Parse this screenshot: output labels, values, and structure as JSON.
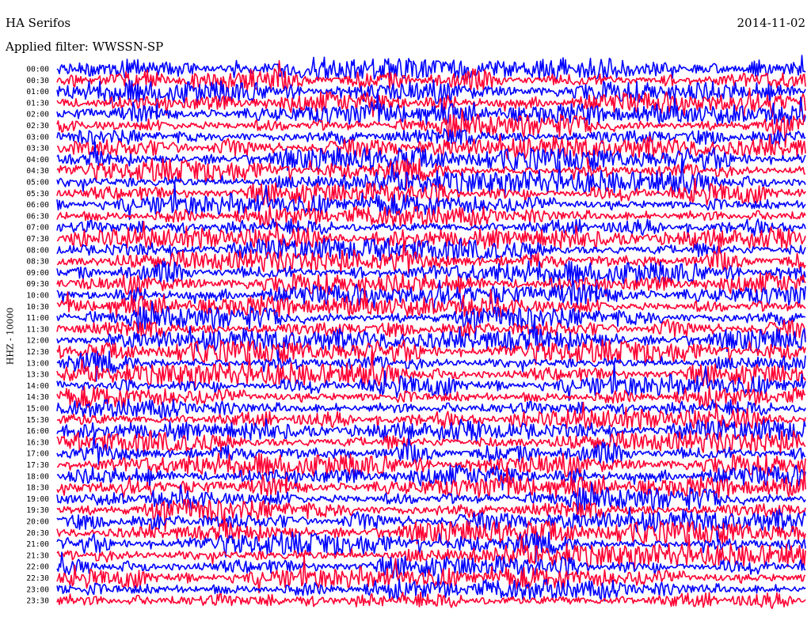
{
  "chart_data": {
    "type": "line",
    "title": "HA Serifos",
    "date": "2014-11-02",
    "filter_label": "Applied filter: WWSSN-SP",
    "ylabel": "HHZ - 10000",
    "rows": [
      "00:00",
      "00:30",
      "01:00",
      "01:30",
      "02:00",
      "02:30",
      "03:00",
      "03:30",
      "04:00",
      "04:30",
      "05:00",
      "05:30",
      "06:00",
      "06:30",
      "07:00",
      "07:30",
      "08:00",
      "08:30",
      "09:00",
      "09:30",
      "10:00",
      "10:30",
      "11:00",
      "11:30",
      "12:00",
      "12:30",
      "13:00",
      "13:30",
      "14:00",
      "14:30",
      "15:00",
      "15:30",
      "16:00",
      "16:30",
      "17:00",
      "17:30",
      "18:00",
      "18:30",
      "19:00",
      "19:30",
      "20:00",
      "20:30",
      "21:00",
      "21:30",
      "22:00",
      "22:30",
      "23:00",
      "23:30"
    ],
    "series_colors": [
      "#0000ff",
      "#ff0033"
    ],
    "grid": false
  }
}
